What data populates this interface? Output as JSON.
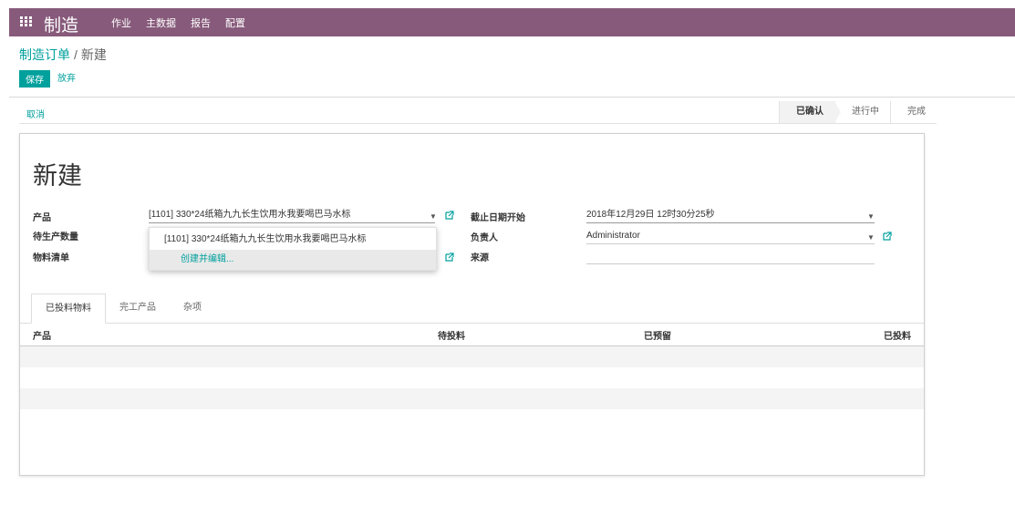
{
  "navbar": {
    "app_name": "制造",
    "menu": [
      "作业",
      "主数据",
      "报告",
      "配置"
    ]
  },
  "breadcrumb": {
    "parent": "制造订单",
    "separator": "/",
    "current": "新建"
  },
  "buttons": {
    "save": "保存",
    "discard": "放弃",
    "cancel": "取消"
  },
  "statusbar": {
    "stages": [
      {
        "label": "已确认",
        "active": true
      },
      {
        "label": "进行中",
        "active": false
      },
      {
        "label": "完成",
        "active": false
      }
    ]
  },
  "form": {
    "title": "新建",
    "product_label": "产品",
    "product_value": "[1101] 330*24纸箱九九长生饮用水我要喝巴马水标",
    "qty_label": "待生产数量",
    "bom_label": "物料清单",
    "deadline_label": "截止日期开始",
    "deadline_value": "2018年12月29日 12时30分25秒",
    "responsible_label": "负责人",
    "responsible_value": "Administrator",
    "source_label": "来源",
    "source_value": ""
  },
  "autocomplete": {
    "option": "[1101] 330*24纸箱九九长生饮用水我要喝巴马水标",
    "create_edit": "创建并编辑..."
  },
  "tabs": [
    "已投料物料",
    "完工产品",
    "杂项"
  ],
  "table": {
    "columns": [
      "产品",
      "待投料",
      "已预留",
      "已投料"
    ],
    "row_count": 6
  },
  "colors": {
    "navbar": "#875a7b",
    "accent": "#00a09d"
  }
}
